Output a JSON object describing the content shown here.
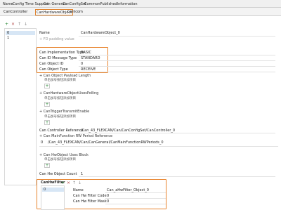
{
  "tabs_top": [
    "Name",
    "Config Time Support",
    "Can General",
    "CanConfigSet",
    "CommonPublishedInformation"
  ],
  "tabs_second": [
    "CanController",
    "CanHardwareObject",
    "CanIcom"
  ],
  "left_panel": {
    "toolbar": [
      "+",
      "×",
      "↑",
      "↓"
    ],
    "items": [
      "0",
      "1"
    ]
  },
  "detail": {
    "name_label": "Name",
    "name_value": "CanHardwareObject_0",
    "fd_padding_label": "+ FD padding value",
    "fields": [
      {
        "label": "Can Implementation Type",
        "value": "BASIC"
      },
      {
        "label": "Can ID Message Type",
        "value": "STANDARD"
      },
      {
        "label": "Can Object ID",
        "value": "0"
      },
      {
        "label": "Can Object Type",
        "value": "RECEIVE"
      }
    ],
    "sections": [
      {
        "head": "+ Can Object Payload Length",
        "hint": "单击加号按钮添加项目"
      },
      {
        "head": "+ CanHardwareObjectUsesPolling",
        "hint": "单击加号按钮添加项目"
      },
      {
        "head": "+ CanTriggerTransmitEnable",
        "hint": "单击加号按钮添加项目"
      }
    ],
    "controller_ref_label": "Can Controller Reference",
    "controller_ref_value": "/Can_43_FLEXCAN/Can/CanConfigSet/CanController_0",
    "mainfunction_label": "+ Can MainFunction RW Period Reference",
    "mainfunction_index": "0",
    "mainfunction_value": "/Can_43_FLEXCAN/Can/CanGeneral/CanMainFunctionRWPeriods_0",
    "uses_block_head": "+ Can HwObject Uses Block",
    "uses_block_hint": "单击加号按钮添加项目",
    "hwobject_count_label": "Can Hw Object Count",
    "hwobject_count_value": "1"
  },
  "hwfilter": {
    "title": "CanHwFilter",
    "toolbar": [
      "+",
      "×",
      "↑",
      "↓"
    ],
    "items": [
      "0"
    ],
    "fields": [
      {
        "label": "Name",
        "value": "Can_aHwFilter_Object_0"
      },
      {
        "label": "Can Hw Filter Code",
        "value": "0"
      },
      {
        "label": "Can Hw Filter Mask",
        "value": "0"
      }
    ]
  },
  "colors": {
    "highlight": "#e8842e",
    "accent_green": "#2e8b3a"
  }
}
